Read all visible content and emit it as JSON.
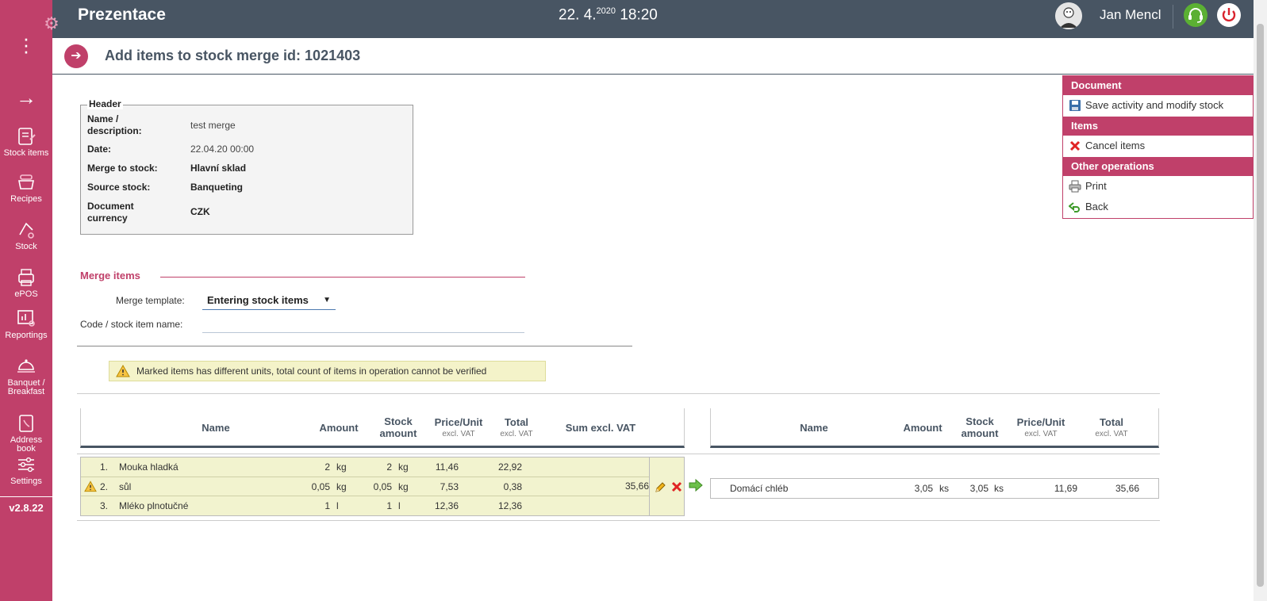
{
  "app": {
    "title": "Prezentace",
    "date": "22. 4.",
    "year": "2020",
    "time": "18:20",
    "user_name": "Jan Mencl",
    "version": "v2.8.22"
  },
  "sidebar": {
    "items": [
      {
        "label": "Stock items",
        "icon": "stock-items-icon"
      },
      {
        "label": "Recipes",
        "icon": "recipes-icon"
      },
      {
        "label": "Stock",
        "icon": "stock-icon"
      },
      {
        "label": "ePOS",
        "icon": "epos-icon"
      },
      {
        "label": "Reportings",
        "icon": "reportings-icon"
      },
      {
        "label": "Banquet /",
        "label2": "Breakfast",
        "icon": "banquet-icon"
      },
      {
        "label": "Address book",
        "icon": "address-book-icon"
      },
      {
        "label": "Settings",
        "icon": "settings-icon"
      }
    ]
  },
  "page": {
    "title": "Add items to stock merge id: 1021403"
  },
  "header_box": {
    "legend": "Header",
    "name_label": "Name /",
    "name_label2": "description:",
    "name_value": "test merge",
    "date_label": "Date:",
    "date_value": "22.04.20 00:00",
    "merge_to_label": "Merge to stock:",
    "merge_to_value": "Hlavní sklad",
    "source_label": "Source stock:",
    "source_value": "Banqueting",
    "currency_label": "Document",
    "currency_label2": "currency",
    "currency_value": "CZK"
  },
  "merge": {
    "title": "Merge items",
    "template_label": "Merge template:",
    "template_value": "Entering stock items",
    "code_label": "Code / stock item name:",
    "code_placeholder": ""
  },
  "warning": {
    "text": "Marked items has different units, total count of items in operation cannot be verified"
  },
  "table_left": {
    "headers": {
      "name": "Name",
      "amount": "Amount",
      "stock_amount": "Stock",
      "stock_amount2": "amount",
      "price_unit": "Price/Unit",
      "price_unit_sub": "excl. VAT",
      "total": "Total",
      "total_sub": "excl. VAT",
      "sum": "Sum excl. VAT"
    },
    "rows": [
      {
        "no": "1.",
        "name": "Mouka hladká",
        "amount": "2",
        "unit": "kg",
        "stock_amount": "2",
        "stock_unit": "kg",
        "price": "11,46",
        "total": "22,92"
      },
      {
        "no": "2.",
        "name": "sůl",
        "amount": "0,05",
        "unit": "kg",
        "stock_amount": "0,05",
        "stock_unit": "kg",
        "price": "7,53",
        "total": "0,38"
      },
      {
        "no": "3.",
        "name": "Mléko plnotučné",
        "amount": "1",
        "unit": "l",
        "stock_amount": "1",
        "stock_unit": "l",
        "price": "12,36",
        "total": "12,36"
      }
    ],
    "sum": "35,66"
  },
  "table_right": {
    "headers": {
      "name": "Name",
      "amount": "Amount",
      "stock_amount": "Stock",
      "stock_amount2": "amount",
      "price_unit": "Price/Unit",
      "price_unit_sub": "excl. VAT",
      "total": "Total",
      "total_sub": "excl. VAT"
    },
    "row": {
      "name": "Domácí chléb",
      "amount": "3,05",
      "unit": "ks",
      "stock_amount": "3,05",
      "stock_unit": "ks",
      "price": "11,69",
      "total": "35,66"
    }
  },
  "actions": {
    "document_head": "Document",
    "save_label": "Save activity and modify stock",
    "items_head": "Items",
    "cancel_label": "Cancel items",
    "other_head": "Other operations",
    "print_label": "Print",
    "back_label": "Back"
  },
  "colors": {
    "brand": "#c0406a",
    "topbar": "#485563",
    "warning_bg": "#f4f3c9",
    "items_bg": "#f2f3cf"
  }
}
